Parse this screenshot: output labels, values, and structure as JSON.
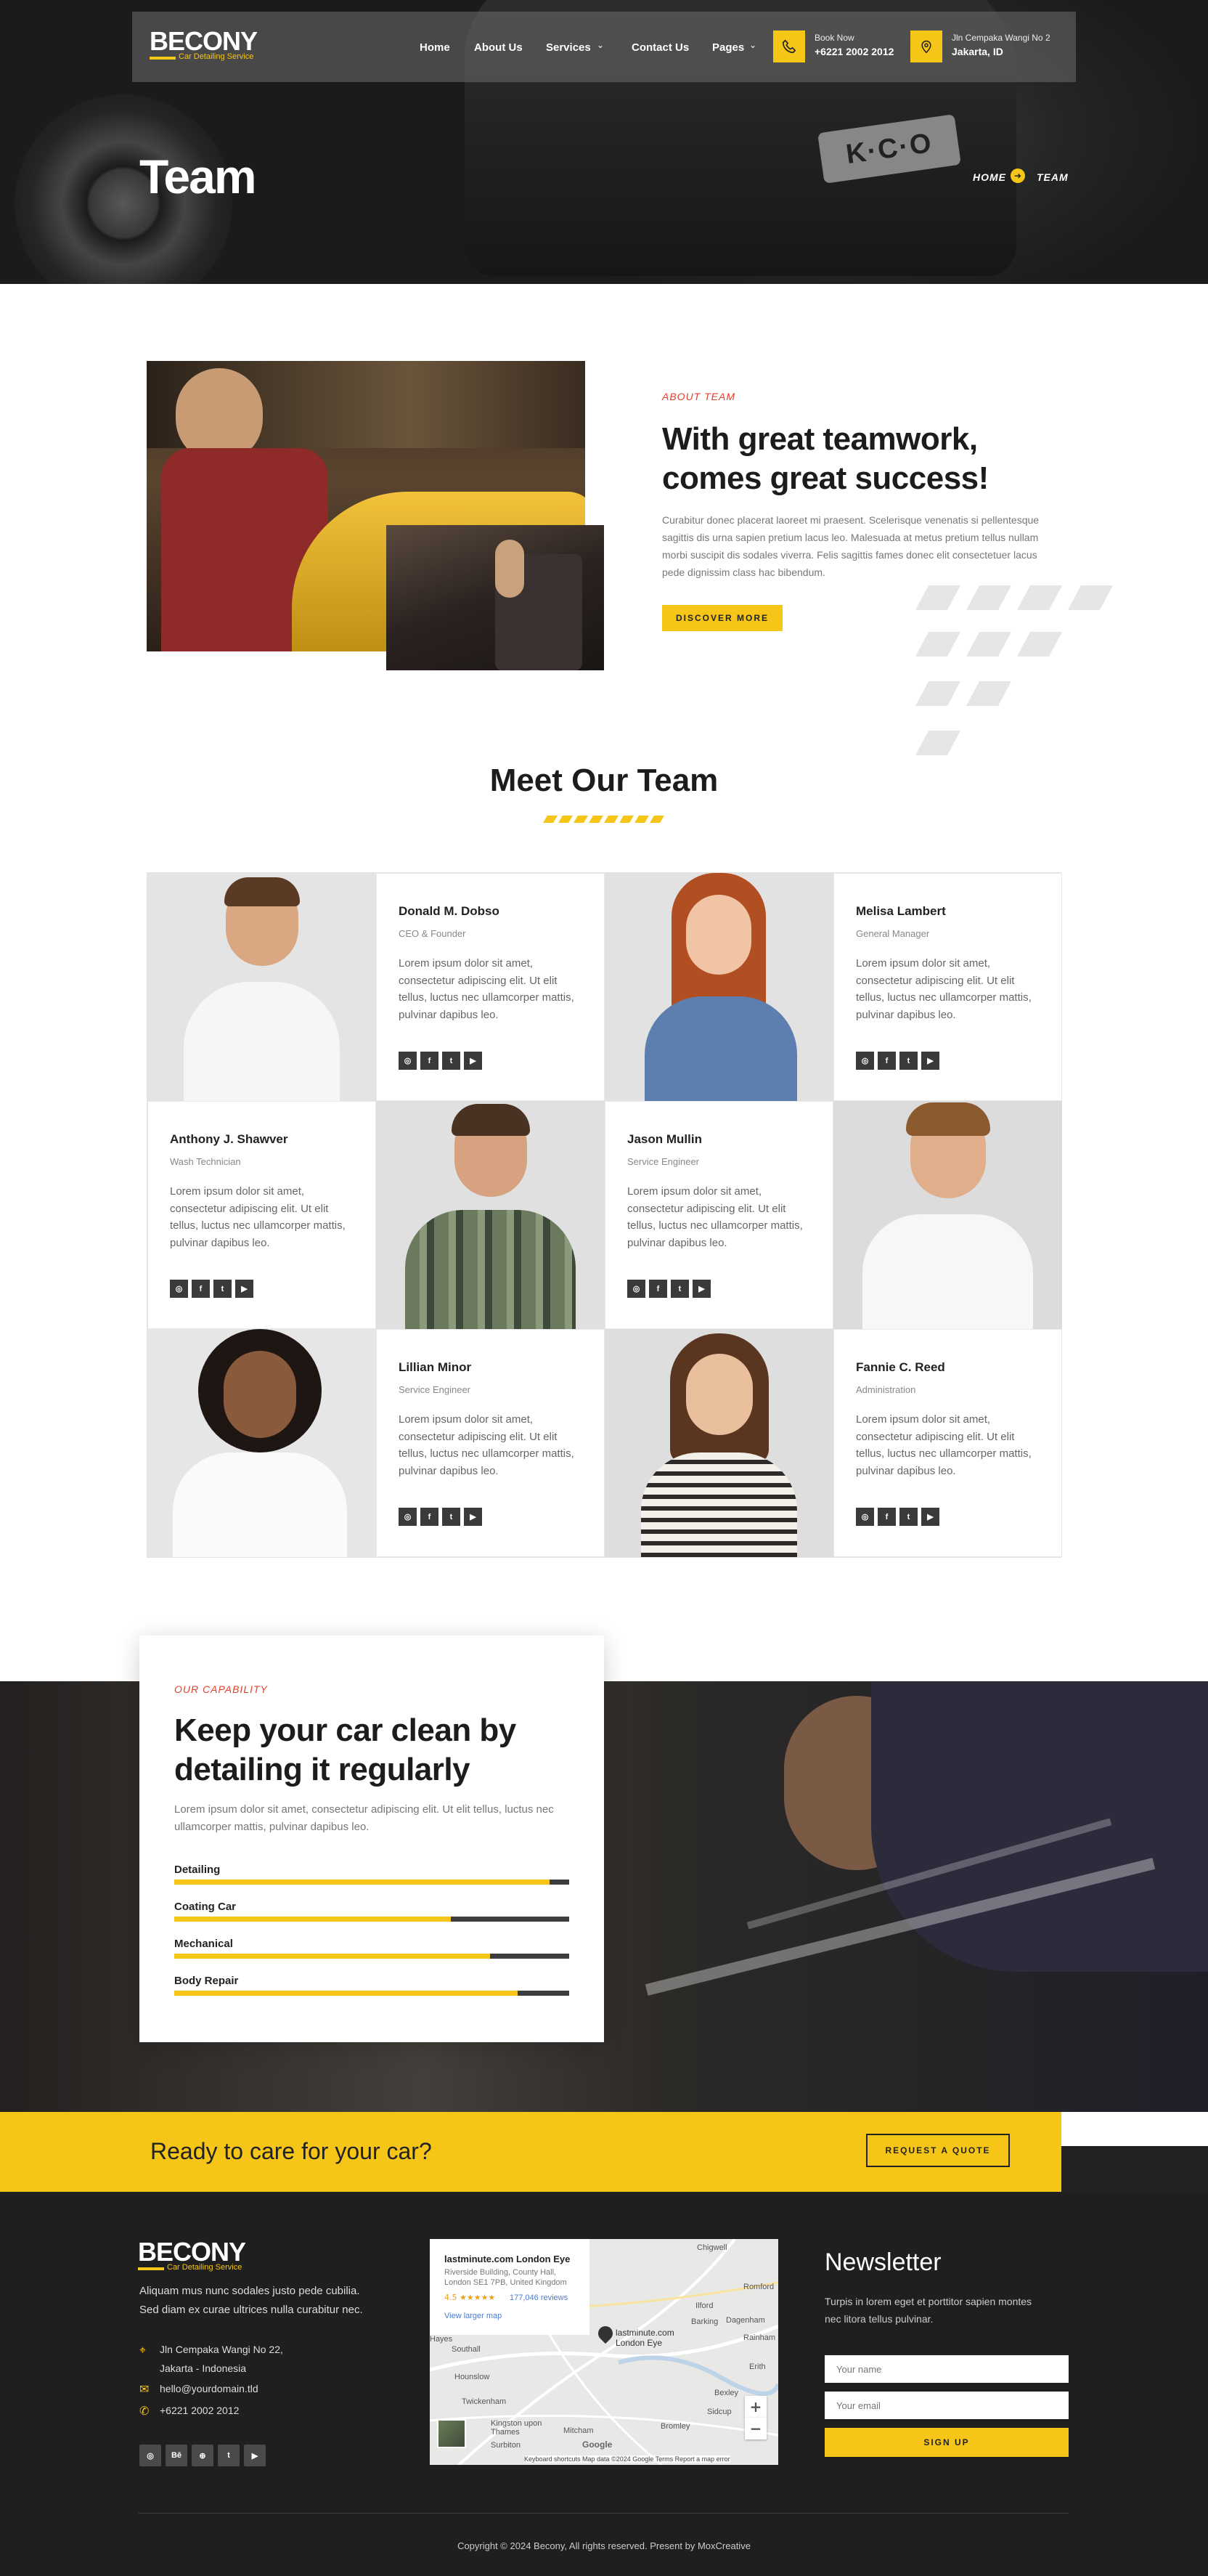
{
  "header": {
    "logo": "BECONY",
    "logo_sub": "Car Detailing Service",
    "nav": [
      "Home",
      "About Us",
      "Services",
      "Contact Us",
      "Pages"
    ],
    "book_label": "Book Now",
    "book_phone": "+6221 2002 2012",
    "addr_line1": "Jln Cempaka Wangi No 2",
    "addr_line2": "Jakarta, ID"
  },
  "hero": {
    "title": "Team",
    "plate": "K·C·O",
    "breadcrumb_home": "HOME",
    "breadcrumb_current": "TEAM"
  },
  "about": {
    "kicker": "ABOUT TEAM",
    "heading_line1": "With great teamwork,",
    "heading_line2": "comes great success!",
    "paragraph": "Curabitur donec placerat laoreet mi praesent. Scelerisque venenatis si pellentesque sagittis dis urna sapien pretium lacus leo. Malesuada at metus pretium tellus nullam morbi suscipit dis sodales viverra. Felis sagittis fames donec elit consectetuer lacus pede dignissim class hac bibendum.",
    "button": "DISCOVER MORE"
  },
  "team": {
    "title": "Meet Our Team",
    "members": [
      {
        "name": "Donald M. Dobso",
        "role": "CEO & Founder",
        "bio": "Lorem ipsum dolor sit amet, consectetur adipiscing elit. Ut elit tellus, luctus nec ullamcorper mattis, pulvinar dapibus leo."
      },
      {
        "name": "Melisa Lambert",
        "role": "General Manager",
        "bio": "Lorem ipsum dolor sit amet, consectetur adipiscing elit. Ut elit tellus, luctus nec ullamcorper mattis, pulvinar dapibus leo."
      },
      {
        "name": "Anthony J. Shawver",
        "role": "Wash Technician",
        "bio": "Lorem ipsum dolor sit amet, consectetur adipiscing elit. Ut elit tellus, luctus nec ullamcorper mattis, pulvinar dapibus leo."
      },
      {
        "name": "Jason Mullin",
        "role": "Service Engineer",
        "bio": "Lorem ipsum dolor sit amet, consectetur adipiscing elit. Ut elit tellus, luctus nec ullamcorper mattis, pulvinar dapibus leo."
      },
      {
        "name": "Lillian Minor",
        "role": "Service Engineer",
        "bio": "Lorem ipsum dolor sit amet, consectetur adipiscing elit. Ut elit tellus, luctus nec ullamcorper mattis, pulvinar dapibus leo."
      },
      {
        "name": "Fannie C. Reed",
        "role": "Administration",
        "bio": "Lorem ipsum dolor sit amet, consectetur adipiscing elit. Ut elit tellus, luctus nec ullamcorper mattis, pulvinar dapibus leo."
      }
    ],
    "social": [
      "◎",
      "f",
      "t",
      "▶"
    ]
  },
  "capability": {
    "kicker": "OUR CAPABILITY",
    "heading_line1": "Keep your car clean by",
    "heading_line2": "detailing it regularly",
    "paragraph": "Lorem ipsum dolor sit amet, consectetur adipiscing elit. Ut elit tellus, luctus nec ullamcorper mattis, pulvinar dapibus leo.",
    "skills": [
      {
        "label": "Detailing",
        "value": 95
      },
      {
        "label": "Coating Car",
        "value": 70
      },
      {
        "label": "Mechanical",
        "value": 80
      },
      {
        "label": "Body Repair",
        "value": 87
      }
    ]
  },
  "cta": {
    "text": "Ready to care for your car?",
    "button": "REQUEST A QUOTE"
  },
  "footer": {
    "logo": "BECONY",
    "logo_sub": "Car Detailing Service",
    "about_line1": "Aliquam mus nunc sodales justo pede cubilia.",
    "about_line2": "Sed diam ex curae ultrices nulla curabitur nec.",
    "address_line1": "Jln Cempaka Wangi No 22,",
    "address_line2": "Jakarta - Indonesia",
    "email": "hello@yourdomain.tld",
    "phone": "+6221 2002 2012",
    "social": [
      "◎",
      "Bē",
      "⊕",
      "t",
      "▶"
    ],
    "map": {
      "place": "lastminute.com London Eye",
      "address_line1": "Riverside Building, County Hall,",
      "address_line2": "London SE1 7PB, United Kingdom",
      "rating": "4.5 ★★★★★",
      "reviews": "177,046 reviews",
      "larger_map": "View larger map",
      "pin_label_line1": "lastminute.com",
      "pin_label_line2": "London Eye",
      "attribution": "Keyboard shortcuts   Map data ©2024 Google   Terms   Report a map error",
      "places": [
        "Chigwell",
        "Romford",
        "Ilford",
        "Barking",
        "Dagenham",
        "Rainham",
        "Erith",
        "Bexley",
        "Sidcup",
        "Bromley",
        "Mitcham",
        "Kingston upon Thames",
        "Surbiton",
        "Twickenham",
        "Hounslow",
        "Southall",
        "Hayes",
        "Google"
      ]
    },
    "newsletter_title": "Newsletter",
    "newsletter_line1": "Turpis in lorem eget et porttitor sapien montes",
    "newsletter_line2": "nec litora tellus pulvinar.",
    "name_placeholder": "Your name",
    "email_placeholder": "Your email",
    "signup": "SIGN UP",
    "copyright": "Copyright © 2024 Becony, All rights reserved. Present by MoxCreative"
  },
  "colors": {
    "accent": "#f5c518",
    "dark": "#1f1f1f",
    "kicker": "#e0412b"
  }
}
